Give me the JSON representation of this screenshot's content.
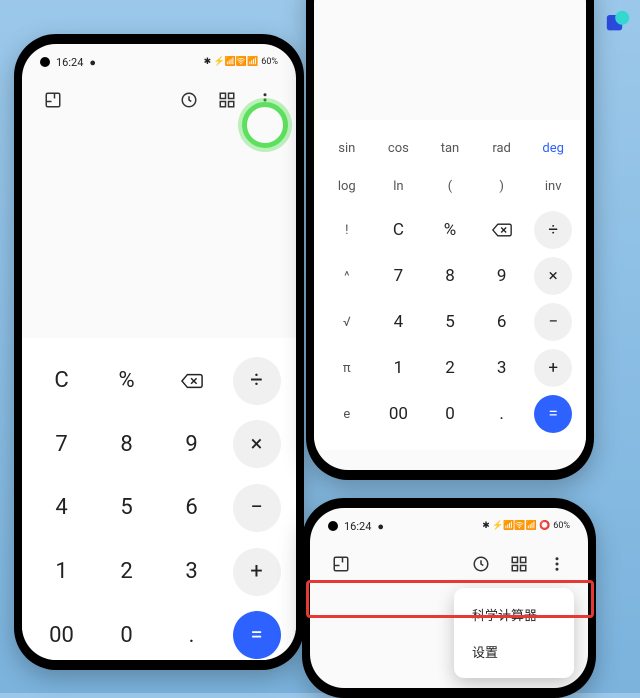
{
  "status": {
    "time": "16:24",
    "battery": "60%",
    "icons_text": "⚡ 📶 🛜 📶 🔋"
  },
  "basic": {
    "keys": [
      [
        "C",
        "%",
        "⌫",
        "÷"
      ],
      [
        "7",
        "8",
        "9",
        "×"
      ],
      [
        "4",
        "5",
        "6",
        "−"
      ],
      [
        "1",
        "2",
        "3",
        "+"
      ],
      [
        "00",
        "0",
        ".",
        "="
      ]
    ]
  },
  "sci": {
    "fn_rows": [
      [
        "sin",
        "cos",
        "tan",
        "rad",
        "deg"
      ],
      [
        "log",
        "ln",
        "(",
        ")",
        "inv"
      ]
    ],
    "main_rows": [
      [
        "!",
        "C",
        "%",
        "⌫",
        "÷"
      ],
      [
        "^",
        "7",
        "8",
        "9",
        "×"
      ],
      [
        "√",
        "4",
        "5",
        "6",
        "−"
      ],
      [
        "π",
        "1",
        "2",
        "3",
        "+"
      ],
      [
        "e",
        "00",
        "0",
        ".",
        "="
      ]
    ],
    "accent_fn": "deg"
  },
  "menu": {
    "items": [
      "科学计算器",
      "设置"
    ]
  }
}
